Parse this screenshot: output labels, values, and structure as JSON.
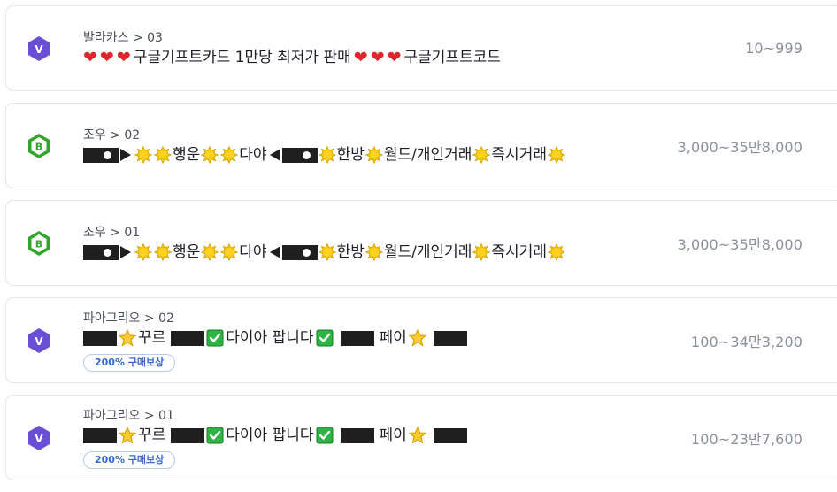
{
  "listings": [
    {
      "badge": "V",
      "badge_color": "#6a4fd6",
      "crumb": "발라카스 > 03",
      "price": "10~999",
      "title_parts": [
        "구글기프트카드 1만당 최저가 판매",
        "구글기프트코드"
      ]
    },
    {
      "badge": "B",
      "badge_color": "#34a52b",
      "crumb": "조우 > 02",
      "price": "3,000~35만8,000",
      "title_parts": [
        "행운",
        "다야",
        "한방",
        "월드/개인거래",
        "즉시거래"
      ]
    },
    {
      "badge": "B",
      "badge_color": "#34a52b",
      "crumb": "조우 > 01",
      "price": "3,000~35만8,000",
      "title_parts": [
        "행운",
        "다야",
        "한방",
        "월드/개인거래",
        "즉시거래"
      ]
    },
    {
      "badge": "V",
      "badge_color": "#6a4fd6",
      "crumb": "파아그리오 > 02",
      "price": "100~34만3,200",
      "title_parts": [
        "꾸르",
        "다이아 팝니다",
        "페이"
      ],
      "pill": "200% 구매보상"
    },
    {
      "badge": "V",
      "badge_color": "#6a4fd6",
      "crumb": "파아그리오 > 01",
      "price": "100~23만7,600",
      "title_parts": [
        "꾸르",
        "다이아 팝니다",
        "페이"
      ],
      "pill": "200% 구매보상"
    }
  ],
  "icons": {
    "heart": "heart-icon",
    "sun": "sun-icon",
    "star": "star-icon",
    "check": "check-icon",
    "badge_v": "v-grade-icon",
    "badge_b": "b-grade-icon"
  }
}
